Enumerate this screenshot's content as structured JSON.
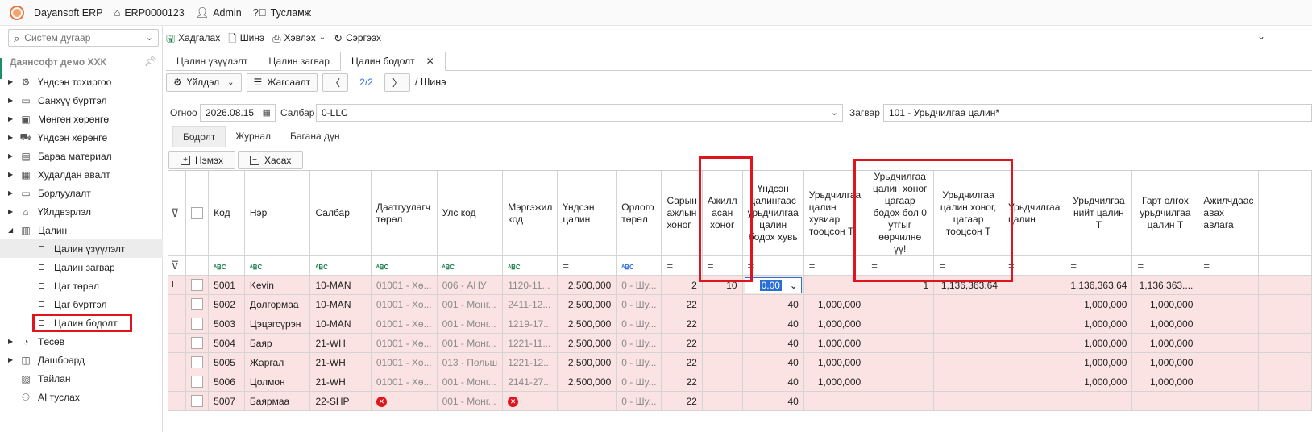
{
  "titlebar": {
    "app_name": "Dayansoft ERP",
    "company_code": "ERP0000123",
    "user": "Admin",
    "help": "Тусламж"
  },
  "sidebar": {
    "search_placeholder": "Систем дугаар",
    "company": "Даянсофт демо ХХК",
    "items": [
      {
        "label": "Үндсэн тохиргоо",
        "icon": "gear-icon"
      },
      {
        "label": "Санхүү бүртгэл",
        "icon": "wallet-icon"
      },
      {
        "label": "Мөнгөн хөрөнгө",
        "icon": "cash-icon"
      },
      {
        "label": "Үндсэн хөрөнгө",
        "icon": "car-icon"
      },
      {
        "label": "Бараа материал",
        "icon": "box-icon"
      },
      {
        "label": "Худалдан авалт",
        "icon": "cart-icon"
      },
      {
        "label": "Борлуулалт",
        "icon": "sales-icon"
      },
      {
        "label": "Үйлдвэрлэл",
        "icon": "factory-icon"
      },
      {
        "label": "Цалин",
        "icon": "calculator-icon"
      },
      {
        "label": "Цалин үзүүлэлт"
      },
      {
        "label": "Цалин загвар"
      },
      {
        "label": "Цаг төрөл"
      },
      {
        "label": "Цаг бүртгэл"
      },
      {
        "label": "Цалин бодолт"
      },
      {
        "label": "Төсөв",
        "icon": "pie-chart-icon"
      },
      {
        "label": "Дашбоард",
        "icon": "dashboard-icon"
      },
      {
        "label": "Тайлан",
        "icon": "report-icon"
      },
      {
        "label": "AI туслах",
        "icon": "ai-icon"
      }
    ]
  },
  "toolbar": {
    "save": "Хадгалах",
    "new": "Шинэ",
    "print": "Хэвлэх",
    "refresh": "Сэргээх"
  },
  "doc_tabs": [
    "Цалин үзүүлэлт",
    "Цалин загвар",
    "Цалин бодолт"
  ],
  "actions": {
    "operation": "Үйлдэл",
    "settings": "Жагсаалт",
    "pager": "2/2",
    "breadcrumb": "/ Шинэ"
  },
  "filters": {
    "date_label": "Огноо",
    "date_value": "2026.08.15",
    "branch_label": "Салбар",
    "branch_value": "0-LLC",
    "template_label": "Загвар",
    "template_value": "101 - Урьдчилгаа цалин*"
  },
  "sub_tabs": [
    "Бодолт",
    "Журнал",
    "Багана дүн"
  ],
  "row_actions": {
    "add": "Нэмэх",
    "remove": "Хасах"
  },
  "grid": {
    "headers": [
      "Код",
      "Нэр",
      "Салбар",
      "Даатгуулагч төрөл",
      "Улс код",
      "Мэргэжил код",
      "Үндсэн цалин",
      "Орлого төрөл",
      "Сарын ажлын хоног",
      "Ажилл асан хоног",
      "Үндсэн цалингаас урьдчилгаа цалин бодох хувь",
      "Урьдчилгаа цалин хувиар тооцсон Т",
      "Урьдчилгаа цалин хоног цагаар бодох бол 0 утгыг өөрчилнө үү!",
      "Урьдчилгаа цалин хоног, цагаар тооцсон Т",
      "Урьдчилгаа цалин",
      "Урьдчилгаа нийт цалин Т",
      "Гарт олгох урьдчилгаа цалин Т",
      "Ажилчдаас авах авлага"
    ],
    "rows": [
      {
        "code": "5001",
        "name": "Kevin",
        "branch": "10-MAN",
        "ins": "01001 - Хө...",
        "country": "006 - АНУ",
        "prof": "1120-11...",
        "base": "2,500,000",
        "income": "0 - Шу...",
        "month_days": "2",
        "worked": "10",
        "pct": "0.00",
        "pct_amt": "",
        "flag": "1",
        "day_amt": "1,136,363.64",
        "adv": "",
        "total": "1,136,363.64",
        "net": "1,136,363....",
        "recv": ""
      },
      {
        "code": "5002",
        "name": "Долгормаа",
        "branch": "10-MAN",
        "ins": "01001 - Хө...",
        "country": "001 - Монг...",
        "prof": "2411-12...",
        "base": "2,500,000",
        "income": "0 - Шу...",
        "month_days": "22",
        "worked": "",
        "pct": "40",
        "pct_amt": "1,000,000",
        "flag": "",
        "day_amt": "",
        "adv": "",
        "total": "1,000,000",
        "net": "1,000,000",
        "recv": ""
      },
      {
        "code": "5003",
        "name": "Цэцэгсүрэн",
        "branch": "10-MAN",
        "ins": "01001 - Хө...",
        "country": "001 - Монг...",
        "prof": "1219-17...",
        "base": "2,500,000",
        "income": "0 - Шу...",
        "month_days": "22",
        "worked": "",
        "pct": "40",
        "pct_amt": "1,000,000",
        "flag": "",
        "day_amt": "",
        "adv": "",
        "total": "1,000,000",
        "net": "1,000,000",
        "recv": ""
      },
      {
        "code": "5004",
        "name": "Баяр",
        "branch": "21-WH",
        "ins": "01001 - Хө...",
        "country": "001 - Монг...",
        "prof": "1221-11...",
        "base": "2,500,000",
        "income": "0 - Шу...",
        "month_days": "22",
        "worked": "",
        "pct": "40",
        "pct_amt": "1,000,000",
        "flag": "",
        "day_amt": "",
        "adv": "",
        "total": "1,000,000",
        "net": "1,000,000",
        "recv": ""
      },
      {
        "code": "5005",
        "name": "Жаргал",
        "branch": "21-WH",
        "ins": "01001 - Хө...",
        "country": "013 - Польш",
        "prof": "1221-12...",
        "base": "2,500,000",
        "income": "0 - Шу...",
        "month_days": "22",
        "worked": "",
        "pct": "40",
        "pct_amt": "1,000,000",
        "flag": "",
        "day_amt": "",
        "adv": "",
        "total": "1,000,000",
        "net": "1,000,000",
        "recv": ""
      },
      {
        "code": "5006",
        "name": "Цолмон",
        "branch": "21-WH",
        "ins": "01001 - Хө...",
        "country": "001 - Монг...",
        "prof": "2141-27...",
        "base": "2,500,000",
        "income": "0 - Шу...",
        "month_days": "22",
        "worked": "",
        "pct": "40",
        "pct_amt": "1,000,000",
        "flag": "",
        "day_amt": "",
        "adv": "",
        "total": "1,000,000",
        "net": "1,000,000",
        "recv": ""
      },
      {
        "code": "5007",
        "name": "Баярмаа",
        "branch": "22-SHP",
        "ins": "",
        "country": "001 - Монг...",
        "prof": "",
        "base": "",
        "income": "0 - Шу...",
        "month_days": "22",
        "worked": "",
        "pct": "40",
        "pct_amt": "",
        "flag": "",
        "day_amt": "",
        "adv": "",
        "total": "",
        "net": "",
        "recv": ""
      }
    ]
  },
  "colors": {
    "row_bg": "#fbe3e4",
    "highlight": "#e0141c",
    "accent": "#2a6fd6"
  }
}
